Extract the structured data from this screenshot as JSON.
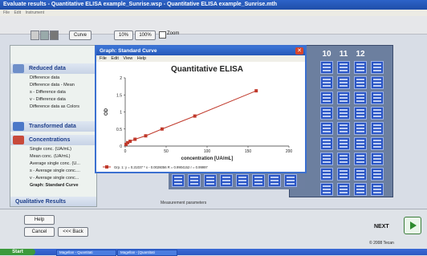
{
  "window": {
    "title": "Evaluate results - Quantitative ELISA example_Sunrise.wsp - Quantitative ELISA example_Sunrise.mth",
    "menu": [
      "File",
      "Edit",
      "Instrument"
    ]
  },
  "toolbar": {
    "curve_label": "Curve",
    "zoom10": "10%",
    "zoom100": "100%",
    "zoom_label": "Zoom"
  },
  "nav": {
    "reduced_header": "Reduced data",
    "reduced_items": [
      "Difference data",
      "Difference data - Mean",
      "s - Difference data",
      "v - Difference data",
      "Difference data as Colors"
    ],
    "transformed_header": "Transformed data",
    "conc_header": "Concentrations",
    "conc_items": [
      "Single conc. (UA/mL)",
      "Mean conc. (UA/mL)",
      "Average single conc. (U...",
      "s - Average single conc....",
      "v - Average single conc...",
      "Graph: Standard Curve"
    ],
    "qual_header": "Qualitative Results"
  },
  "graph_window": {
    "title": "Graph: Standard Curve",
    "close": "✕",
    "menu": [
      "File",
      "Edit",
      "View",
      "Help"
    ]
  },
  "chart_data": {
    "type": "line",
    "title": "Quantitative ELISA",
    "xlabel": "concentration [UA/mL]",
    "ylabel": "OD",
    "xlim": [
      0,
      200
    ],
    "ylim": [
      0,
      2
    ],
    "xticks": [
      0,
      50,
      100,
      150,
      200
    ],
    "yticks": [
      0,
      0.5,
      1,
      1.5,
      2
    ],
    "grid": false,
    "series": [
      {
        "name": "Grp. 1: y = 0.21037 * x - 0.0026056  R = 0.9904152  r = 0.99997",
        "color": "#c0392b",
        "x": [
          1,
          3,
          6,
          12,
          25,
          45,
          85,
          160
        ],
        "y": [
          0.05,
          0.1,
          0.14,
          0.2,
          0.3,
          0.5,
          0.88,
          1.62
        ]
      }
    ]
  },
  "plate": {
    "columns": [
      "10",
      "11",
      "12"
    ],
    "rows": 9
  },
  "status": {
    "measurement_label": "Measurement parameters",
    "copyright": "© 2008 Tecan"
  },
  "bottom": {
    "help": "Help",
    "cancel": "Cancel",
    "back": "<<< Back",
    "next": "NEXT"
  },
  "taskbar": {
    "start": "Start",
    "tasks": [
      "Magellan - Quantitati",
      "Magellan - [Quantitati"
    ]
  },
  "colors": {
    "accent": "#2b56c5",
    "curve": "#c0392b",
    "nav_text": "#1d3e8a"
  }
}
